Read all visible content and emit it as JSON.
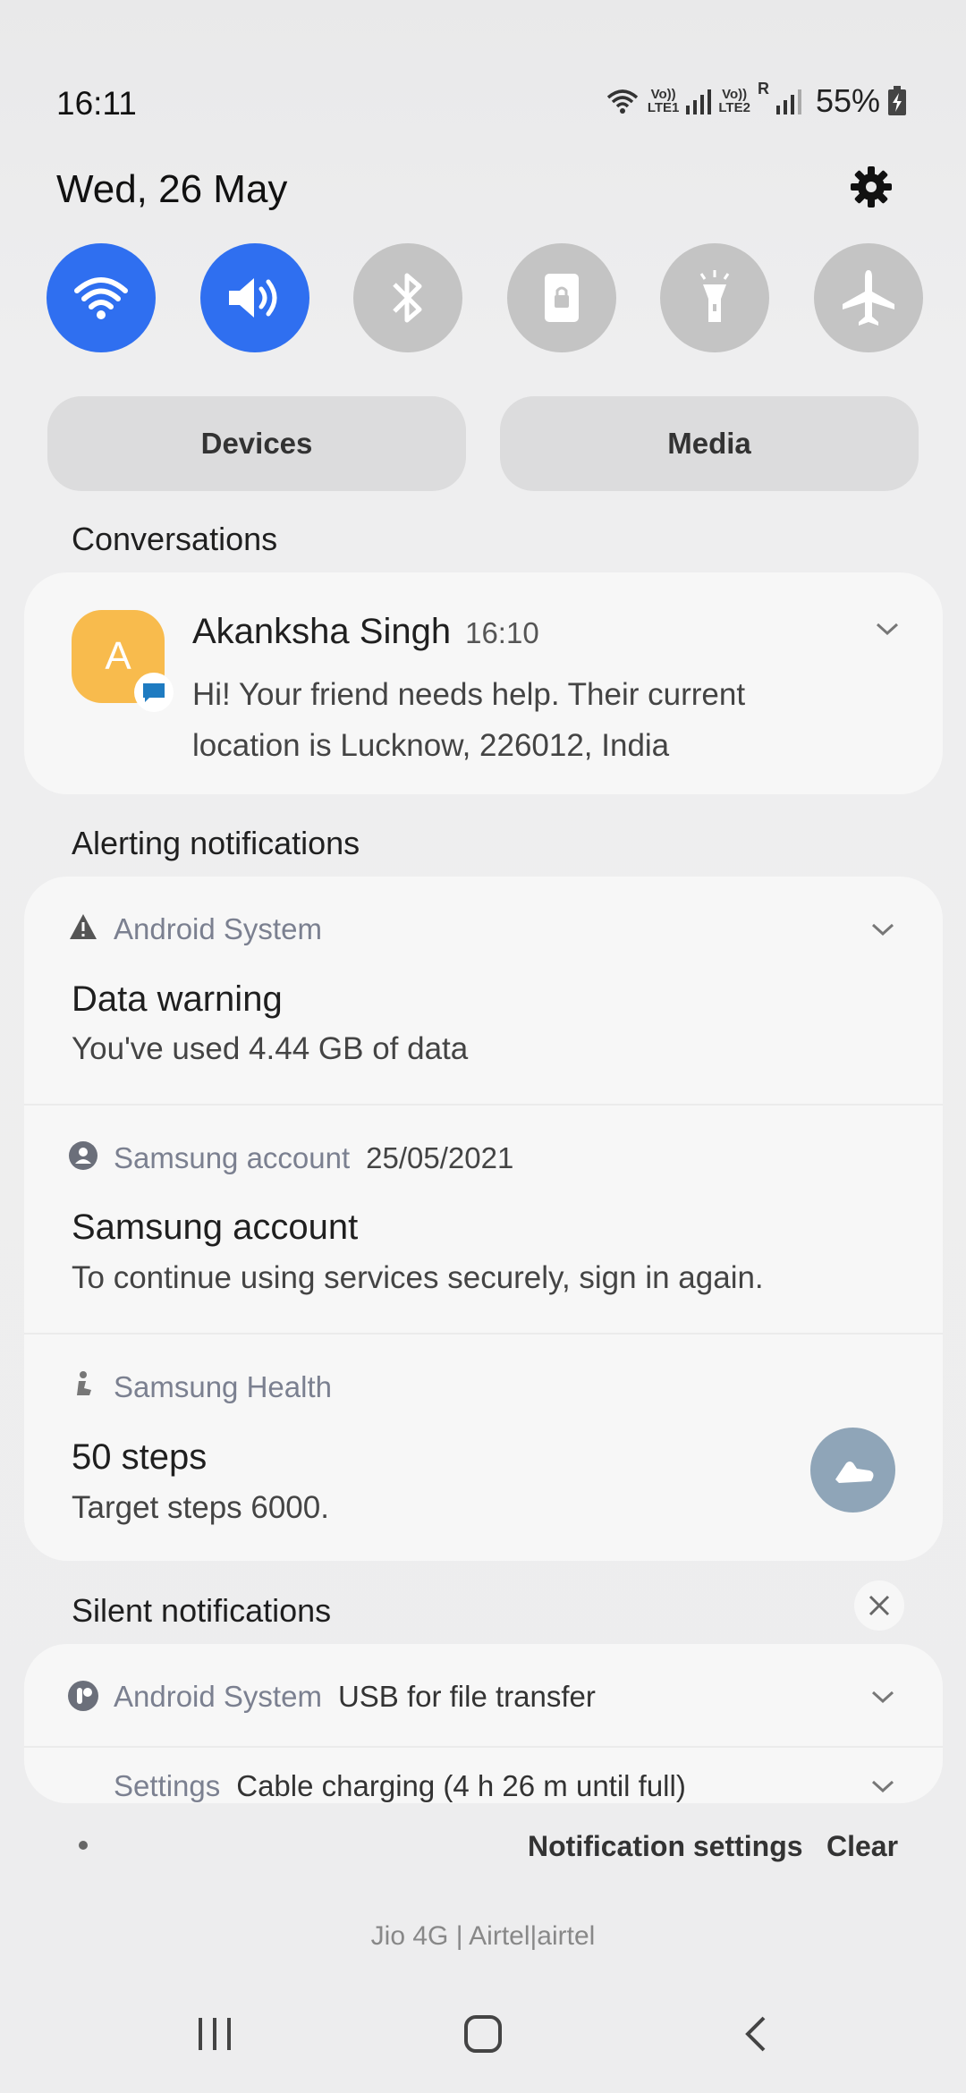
{
  "status": {
    "time": "16:11",
    "sim1_label_top": "Vo))",
    "sim1_label_bottom": "LTE1",
    "sim2_label_top": "Vo))",
    "sim2_label_bottom": "LTE2",
    "roaming": "R",
    "battery": "55%"
  },
  "date": "Wed, 26 May",
  "quick_toggles": [
    {
      "name": "wifi",
      "on": true
    },
    {
      "name": "sound",
      "on": true
    },
    {
      "name": "bluetooth",
      "on": false
    },
    {
      "name": "lock-rotation",
      "on": false
    },
    {
      "name": "flashlight",
      "on": false
    },
    {
      "name": "airplane",
      "on": false
    }
  ],
  "panel_buttons": {
    "devices": "Devices",
    "media": "Media"
  },
  "conversations": {
    "label": "Conversations",
    "item": {
      "avatar_letter": "A",
      "name": "Akanksha Singh",
      "time": "16:10",
      "message": "Hi! Your friend needs help. Their current location is Lucknow, 226012, India"
    }
  },
  "alerting": {
    "label": "Alerting notifications",
    "items": [
      {
        "app": "Android System",
        "timestamp": "",
        "title": "Data warning",
        "body": "You've used 4.44 GB of data"
      },
      {
        "app": "Samsung account",
        "timestamp": "25/05/2021",
        "title": "Samsung account",
        "body": "To continue using services securely, sign in again."
      },
      {
        "app": "Samsung Health",
        "timestamp": "",
        "title": "50 steps",
        "body": "Target steps 6000."
      }
    ]
  },
  "silent": {
    "label": "Silent notifications",
    "items": [
      {
        "app": "Android System",
        "text": "USB for file transfer"
      },
      {
        "app": "Settings",
        "text": "Cable charging (4 h 26 m until full)"
      }
    ]
  },
  "footer": {
    "notification_settings": "Notification settings",
    "clear": "Clear",
    "carrier": "Jio 4G | Airtel|airtel"
  },
  "colors": {
    "accent": "#2f6ff0",
    "toggle_off": "#c4c4c4",
    "health_button": "#8fa5b8"
  }
}
